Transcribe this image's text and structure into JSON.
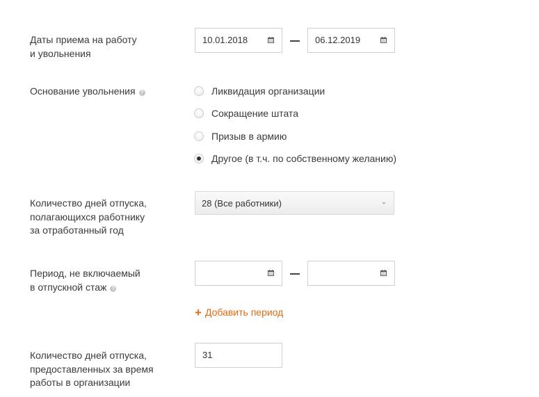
{
  "employment_dates": {
    "label_line1": "Даты приема на работу",
    "label_line2": "и увольнения",
    "start_date": "10.01.2018",
    "end_date": "06.12.2019"
  },
  "dismissal": {
    "label": "Основание увольнения",
    "options": [
      {
        "label": "Ликвидация организации",
        "checked": false
      },
      {
        "label": "Сокращение штата",
        "checked": false
      },
      {
        "label": "Призыв в армию",
        "checked": false
      },
      {
        "label": "Другое (в т.ч. по собственному желанию)",
        "checked": true
      }
    ]
  },
  "vacation_days": {
    "label_line1": "Количество дней отпуска,",
    "label_line2": "полагающихся работнику",
    "label_line3": "за отработанный год",
    "selected": "28 (Все работники)"
  },
  "excluded_period": {
    "label_line1": "Период, не включаемый",
    "label_line2": "в отпускной стаж",
    "start_date": "",
    "end_date": "",
    "add_label": "Добавить период"
  },
  "days_granted": {
    "label_line1": "Количество дней отпуска,",
    "label_line2": "предоставленных за время",
    "label_line3": "работы в организации",
    "value": "31"
  }
}
